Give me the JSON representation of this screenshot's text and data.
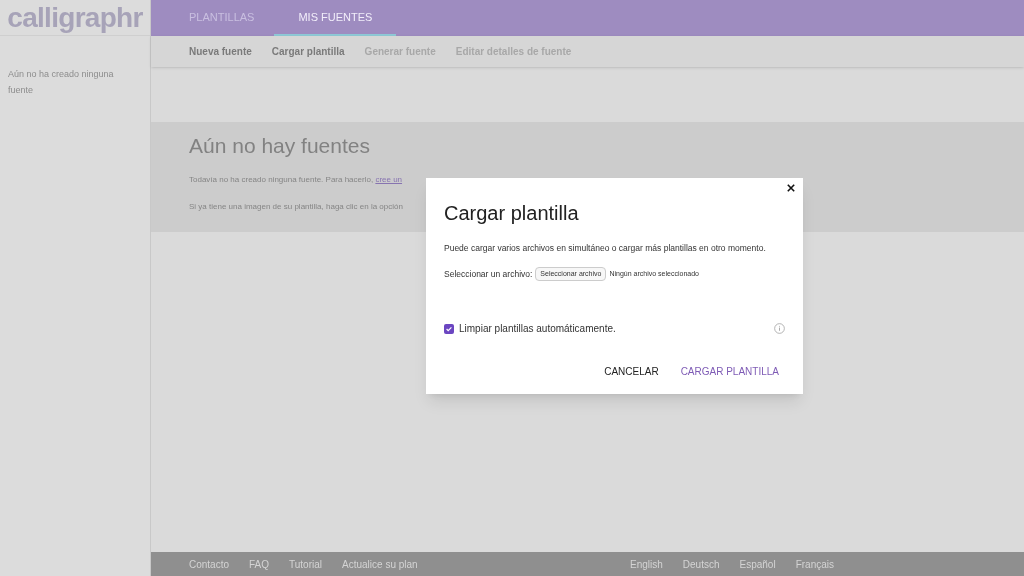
{
  "logo": "calligraphr",
  "nav_tabs": [
    {
      "label": "PLANTILLAS",
      "selected": false
    },
    {
      "label": "MIS FUENTES",
      "selected": true
    }
  ],
  "sub_nav": [
    {
      "label": "Nueva fuente",
      "disabled": false
    },
    {
      "label": "Cargar plantilla",
      "disabled": false
    },
    {
      "label": "Generar fuente",
      "disabled": true
    },
    {
      "label": "Editar detalles de fuente",
      "disabled": true
    }
  ],
  "sidebar": {
    "message": "Aún no ha creado ninguna fuente"
  },
  "empty_state": {
    "title": "Aún no hay fuentes",
    "line_1": "Todavía no ha creado ninguna fuente. Para hacerlo,",
    "line_1_link": "cree un",
    "line_2": "Si ya tiene una imagen de su plantilla, haga clic en la opción"
  },
  "dialog": {
    "title": "Cargar plantilla",
    "description": "Puede cargar varios archivos en simultáneo o cargar más plantillas en otro momento.",
    "file_label": "Seleccionar un archivo:",
    "file_button": "Seleccionar archivo",
    "file_status": "Ningún archivo seleccionado",
    "checkbox": {
      "label": "Limpiar plantillas automáticamente.",
      "checked": true
    },
    "buttons": [
      {
        "label": "CANCELAR",
        "kind": "plain"
      },
      {
        "label": "CARGAR PLANTILLA",
        "kind": "primary"
      }
    ]
  },
  "footer": {
    "links": [
      "Contacto",
      "FAQ",
      "Tutorial",
      "Actualice su plan"
    ],
    "languages": [
      "English",
      "Deutsch",
      "Español",
      "Français"
    ]
  }
}
